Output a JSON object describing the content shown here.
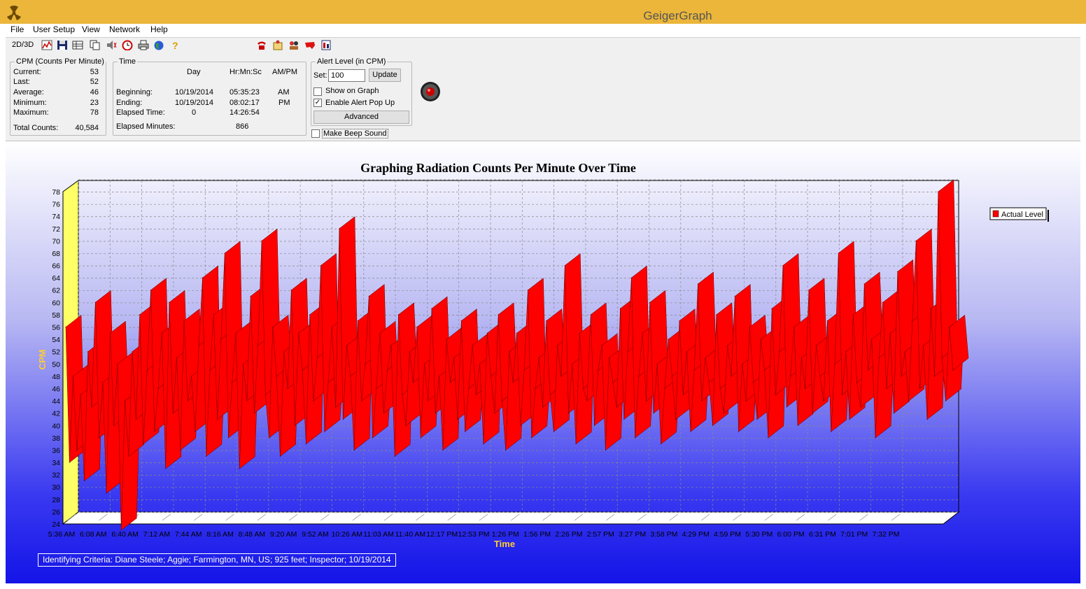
{
  "window": {
    "title": "GeigerGraph"
  },
  "menu": [
    "File",
    "User Setup",
    "View",
    "Network",
    "Help"
  ],
  "toolbar": {
    "mode_label": "2D/3D"
  },
  "cpm": {
    "legend": "CPM (Counts Per Minute)",
    "rows": [
      {
        "label": "Current:",
        "value": "53"
      },
      {
        "label": "Last:",
        "value": "52"
      },
      {
        "label": "Average:",
        "value": "46"
      },
      {
        "label": "Minimum:",
        "value": "23"
      },
      {
        "label": "Maximum:",
        "value": "78"
      }
    ],
    "total_label": "Total Counts:",
    "total_value": "40,584"
  },
  "time": {
    "legend": "Time",
    "col_day": "Day",
    "col_hms": "Hr:Mn:Sc",
    "col_ampm": "AM/PM",
    "beginning": {
      "label": "Beginning:",
      "day": "10/19/2014",
      "hms": "05:35:23",
      "ampm": "AM"
    },
    "ending": {
      "label": "Ending:",
      "day": "10/19/2014",
      "hms": "08:02:17",
      "ampm": "PM"
    },
    "elapsed": {
      "label": "Elapsed Time:",
      "day": "0",
      "hms": "14:26:54"
    },
    "minutes": {
      "label": "Elapsed Minutes:",
      "value": "866"
    }
  },
  "alert": {
    "legend": "Alert Level (in CPM)",
    "set_label": "Set:",
    "set_value": "100",
    "update_label": "Update",
    "show_on_graph": {
      "label": "Show on Graph",
      "checked": false
    },
    "enable_popup": {
      "label": "Enable Alert Pop Up",
      "checked": true
    },
    "advanced_label": "Advanced",
    "beep": {
      "label": "Make Beep Sound",
      "checked": false
    }
  },
  "criteria": "Identifying Criteria:  Diane Steele;  Aggie;  Farmington, MN, US;  925 feet;  Inspector;  10/19/2014",
  "chart_data": {
    "type": "area",
    "title": "Graphing Radiation Counts Per Minute Over Time",
    "xlabel": "Time",
    "ylabel": "CPM",
    "ylim": [
      24,
      78
    ],
    "yticks": [
      24,
      26,
      28,
      30,
      32,
      34,
      36,
      38,
      40,
      42,
      44,
      46,
      48,
      50,
      52,
      54,
      56,
      58,
      60,
      62,
      64,
      66,
      68,
      70,
      72,
      74,
      76,
      78
    ],
    "xticks": [
      "5:36 AM",
      "6:08 AM",
      "6:40 AM",
      "7:12 AM",
      "7:44 AM",
      "8:16 AM",
      "8:48 AM",
      "9:20 AM",
      "9:52 AM",
      "10:26 AM",
      "11:03 AM",
      "11:40 AM",
      "12:17 PM",
      "12:53 PM",
      "1:26 PM",
      "1:56 PM",
      "2:26 PM",
      "2:57 PM",
      "3:27 PM",
      "3:58 PM",
      "4:29 PM",
      "4:59 PM",
      "5:30 PM",
      "6:00 PM",
      "6:31 PM",
      "7:01 PM",
      "7:32 PM"
    ],
    "grid": true,
    "legend_position": "right",
    "series": [
      {
        "name": "Actual Level",
        "color": "#ff0000",
        "values": [
          56,
          34,
          48,
          36,
          45,
          31,
          52,
          43,
          60,
          38,
          47,
          29,
          55,
          40,
          50,
          23,
          44,
          35,
          52,
          41,
          58,
          37,
          49,
          62,
          39,
          46,
          55,
          33,
          60,
          42,
          51,
          36,
          57,
          44,
          48,
          39,
          53,
          64,
          35,
          49,
          58,
          41,
          54,
          68,
          38,
          47,
          55,
          33,
          50,
          44,
          61,
          42,
          53,
          70,
          45,
          38,
          56,
          48,
          35,
          52,
          46,
          62,
          40,
          55,
          49,
          37,
          58,
          44,
          51,
          66,
          39,
          47,
          56,
          43,
          72,
          41,
          53,
          48,
          36,
          57,
          44,
          50,
          61,
          38,
          46,
          55,
          42,
          49,
          53,
          35,
          58,
          45,
          40,
          52,
          47,
          56,
          38,
          50,
          44,
          59,
          42,
          48,
          36,
          54,
          47,
          51,
          41,
          57,
          39,
          46,
          53,
          45,
          50,
          37,
          55,
          48,
          42,
          58,
          44,
          36,
          52,
          47,
          55,
          40,
          49,
          62,
          38,
          46,
          51,
          43,
          57,
          45,
          39,
          53,
          48,
          66,
          42,
          50,
          37,
          55,
          46,
          44,
          58,
          40,
          49,
          53,
          36,
          51,
          47,
          43,
          59,
          41,
          52,
          64,
          38,
          48,
          55,
          44,
          60,
          42,
          50,
          37,
          46,
          54,
          48,
          41,
          57,
          45,
          52,
          39,
          49,
          63,
          44,
          51,
          47,
          40,
          58,
          46,
          42,
          53,
          48,
          61,
          39,
          50,
          44,
          56,
          47,
          41,
          54,
          49,
          38,
          59,
          45,
          52,
          66,
          43,
          48,
          56,
          40,
          51,
          46,
          62,
          42,
          53,
          48,
          44,
          57,
          39,
          50,
          68,
          45,
          52,
          41,
          58,
          47,
          43,
          63,
          49,
          54,
          38,
          51,
          60,
          46,
          55,
          42,
          65,
          48,
          52,
          44,
          57,
          70,
          46,
          53,
          41,
          59,
          48,
          78,
          51,
          44,
          56,
          49
        ]
      }
    ]
  },
  "colors": {
    "titlebar": "#ebb63a",
    "chart_series": "#ff0000",
    "axis_label": "#ffcc33",
    "wall": "#ffff66",
    "background_bottom": "#1414e8"
  }
}
